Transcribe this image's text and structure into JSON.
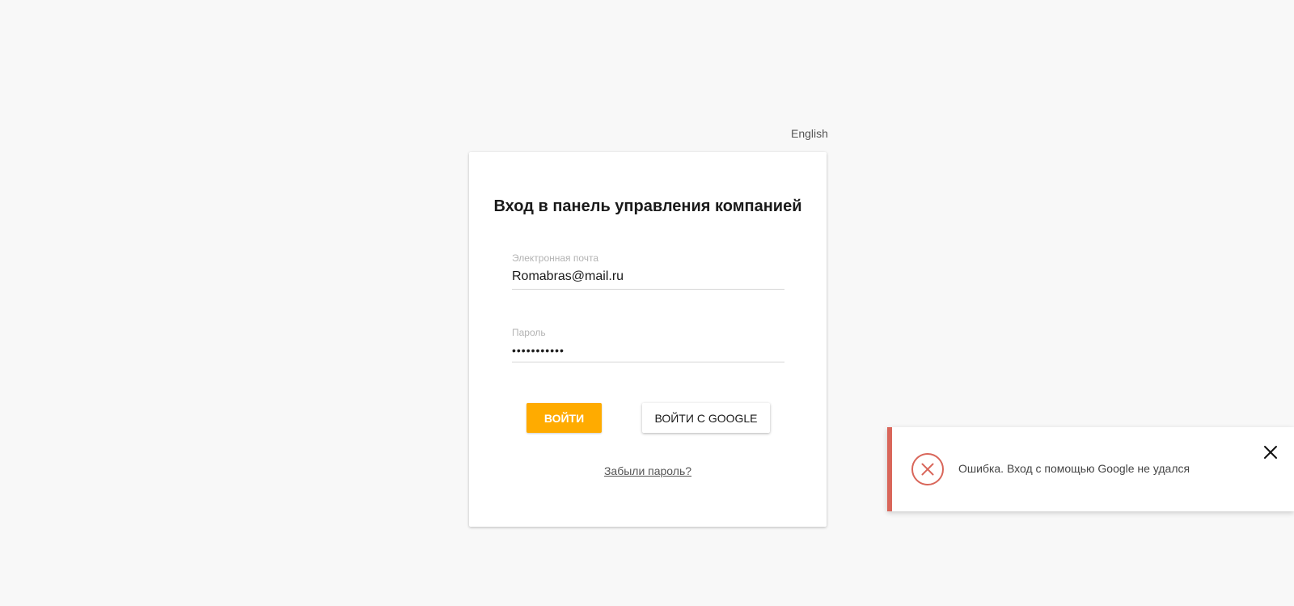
{
  "header": {
    "language_link": "English"
  },
  "login_card": {
    "title": "Вход в панель управления компанией",
    "email": {
      "label": "Электронная почта",
      "value": "Romabras@mail.ru"
    },
    "password": {
      "label": "Пароль",
      "value": "•••••••••••"
    },
    "login_button": "ВОЙТИ",
    "google_button": "ВОЙТИ С GOOGLE",
    "forgot_link": "Забыли пароль?"
  },
  "toast": {
    "type": "error",
    "icon": "error-circle-x-icon",
    "message": "Ошибка. Вход с помощью Google не удался",
    "close_icon": "close-icon",
    "accent_color": "#d9665a"
  },
  "colors": {
    "primary": "#ffab00",
    "background": "#f8f8f8",
    "error": "#d9665a"
  }
}
